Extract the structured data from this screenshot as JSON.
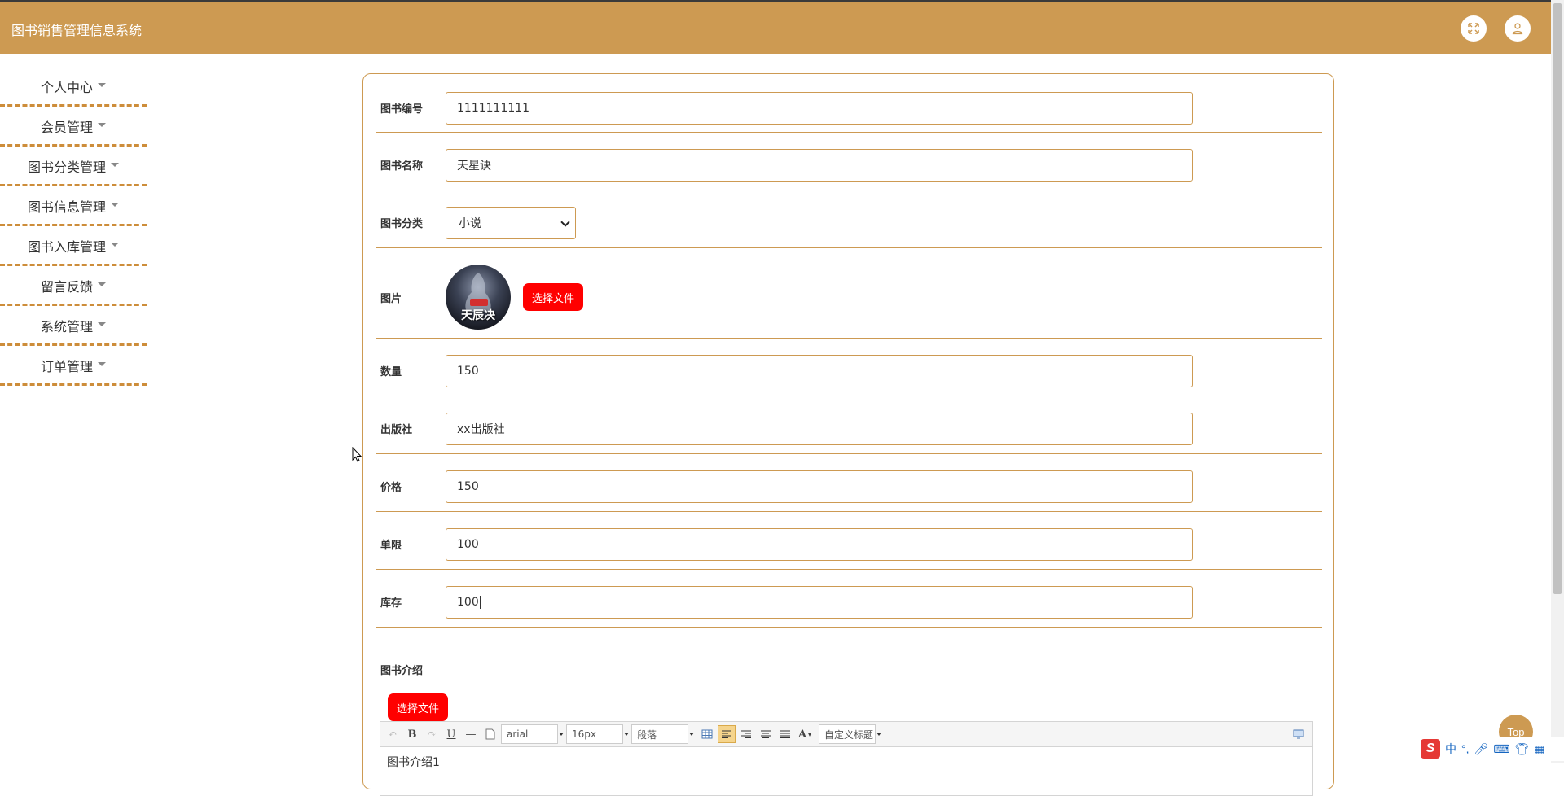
{
  "app": {
    "title": "图书销售管理信息系统"
  },
  "header": {
    "fullscreen_icon": "fullscreen-icon",
    "user_icon": "user-icon"
  },
  "sidebar": {
    "items": [
      {
        "label": "个人中心"
      },
      {
        "label": "会员管理"
      },
      {
        "label": "图书分类管理"
      },
      {
        "label": "图书信息管理"
      },
      {
        "label": "图书入库管理"
      },
      {
        "label": "留言反馈"
      },
      {
        "label": "系统管理"
      },
      {
        "label": "订单管理"
      }
    ]
  },
  "form": {
    "book_no": {
      "label": "图书编号",
      "value": "1111111111"
    },
    "book_name": {
      "label": "图书名称",
      "value": "天星诀"
    },
    "category": {
      "label": "图书分类",
      "value": "小说"
    },
    "image": {
      "label": "图片",
      "button": "选择文件",
      "cover_text": "天辰决"
    },
    "quantity": {
      "label": "数量",
      "value": "150"
    },
    "publisher": {
      "label": "出版社",
      "value": "xx出版社"
    },
    "price": {
      "label": "价格",
      "value": "150"
    },
    "limit": {
      "label": "单限",
      "value": "100"
    },
    "stock": {
      "label": "库存",
      "value": "100"
    },
    "intro": {
      "label": "图书介绍",
      "button": "选择文件",
      "content": "图书介绍1"
    }
  },
  "editor_toolbar": {
    "bold": "B",
    "underline": "U",
    "font_family": "arial",
    "font_size": "16px",
    "paragraph": "段落",
    "font_color": "A",
    "custom_title": "自定义标题"
  },
  "top_button": {
    "label": "Top"
  },
  "ime": {
    "mode": "中"
  },
  "colors": {
    "accent": "#cd9a52",
    "danger": "#ff0000",
    "divider": "#cd8d3a"
  }
}
